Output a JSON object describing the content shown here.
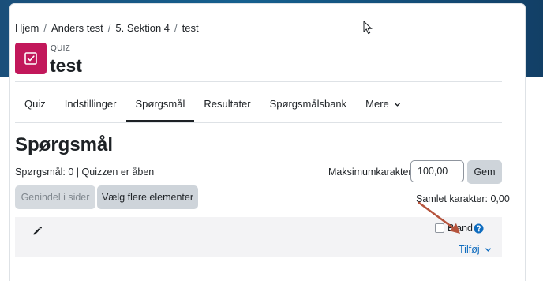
{
  "breadcrumb": {
    "items": [
      "Hjem",
      "Anders test",
      "5. Sektion 4",
      "test"
    ],
    "separator": "/"
  },
  "module": {
    "type_label": "QUIZ",
    "title": "test",
    "icon": "quiz-checkbox-icon",
    "icon_color": "#c2185b"
  },
  "tabs": [
    {
      "label": "Quiz",
      "active": false
    },
    {
      "label": "Indstillinger",
      "active": false
    },
    {
      "label": "Spørgsmål",
      "active": true
    },
    {
      "label": "Resultater",
      "active": false
    },
    {
      "label": "Spørgsmålsbank",
      "active": false
    },
    {
      "label": "Mere",
      "active": false,
      "has_dropdown": true
    }
  ],
  "page": {
    "title": "Spørgsmål",
    "status": "Spørgsmål: 0 | Quizzen er åben"
  },
  "max_grade": {
    "label": "Maksimumkarakter",
    "value": "100,00",
    "save_label": "Gem"
  },
  "buttons": {
    "repaginate": "Genindel i sider",
    "select_multiple": "Vælg flere elementer"
  },
  "total_grade": "Samlet karakter: 0,00",
  "section": {
    "shuffle_label": "Bland",
    "shuffle_checked": false,
    "add_label": "Tilføj"
  },
  "colors": {
    "header_band": "#15608f",
    "link": "#0f6cbf",
    "annotation_arrow": "#b5533c"
  }
}
